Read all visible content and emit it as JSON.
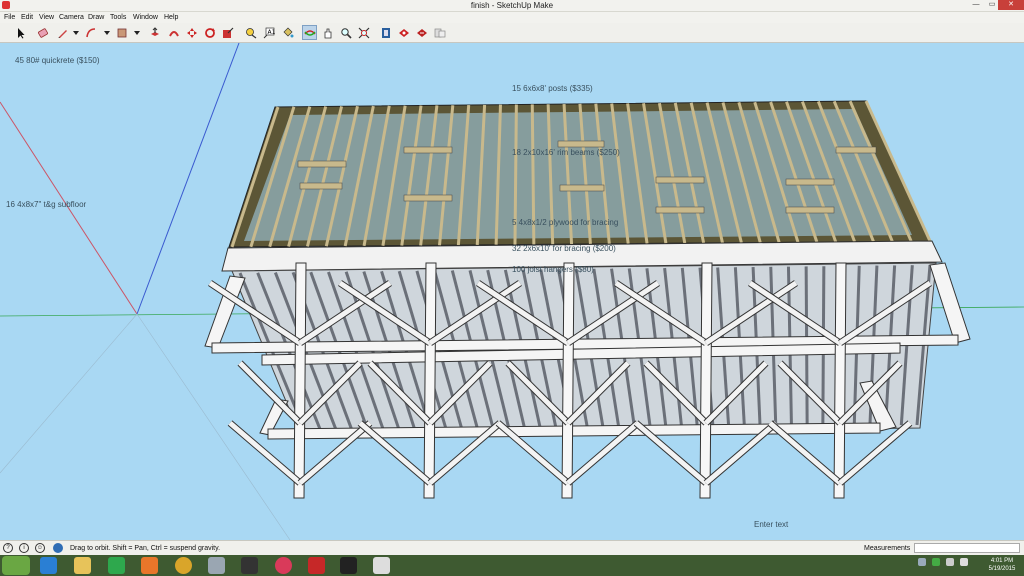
{
  "window": {
    "title": "finish - SketchUp Make",
    "minimize_glyph": "—",
    "maximize_glyph": "▭",
    "close_glyph": "✕"
  },
  "menu": {
    "items": [
      "File",
      "Edit",
      "View",
      "Camera",
      "Draw",
      "Tools",
      "Window",
      "Help"
    ]
  },
  "toolbar": {
    "tools": [
      "select-icon",
      "eraser-icon",
      "pencil-icon",
      "arc-icon",
      "rectangle-icon",
      "push-pull-icon",
      "follow-me-icon",
      "move-icon",
      "rotate-icon",
      "scale-icon",
      "tape-measure-icon",
      "text-icon",
      "paint-bucket-icon",
      "orbit-icon",
      "pan-icon",
      "zoom-icon",
      "zoom-extents-icon",
      "3d-warehouse-icon",
      "extension-warehouse-icon",
      "model-info-icon",
      "layout-icon"
    ]
  },
  "model_labels": {
    "concrete": "45 80# quickrete ($150)",
    "posts": "15 6x6x8' posts ($335)",
    "beams": "18 2x10x16' rim beams ($250)",
    "subfloor": "16 4x8x7\" t&g subfloor",
    "plywood": "5 4x8x1/2 plywood for bracing",
    "bracing": "32 2x6x10' for bracing ($200)",
    "hangers": "100 joist hangers ($80)"
  },
  "viewport": {
    "sky_color": "#a9d8f3",
    "enter_text": "Enter text"
  },
  "status": {
    "hint": "Drag to orbit. Shift = Pan, Ctrl = suspend gravity.",
    "measurements_label": "Measurements",
    "measurements_value": ""
  },
  "taskbar": {
    "apps": [
      "start-button",
      "internet-explorer-icon",
      "file-explorer-icon",
      "store-icon",
      "media-player-icon",
      "chrome-icon",
      "calculator-icon",
      "photo-icon",
      "itunes-icon",
      "sketchup-icon",
      "terminal-icon",
      "camera-icon"
    ],
    "time": "4:01 PM",
    "date": "5/19/2015"
  }
}
